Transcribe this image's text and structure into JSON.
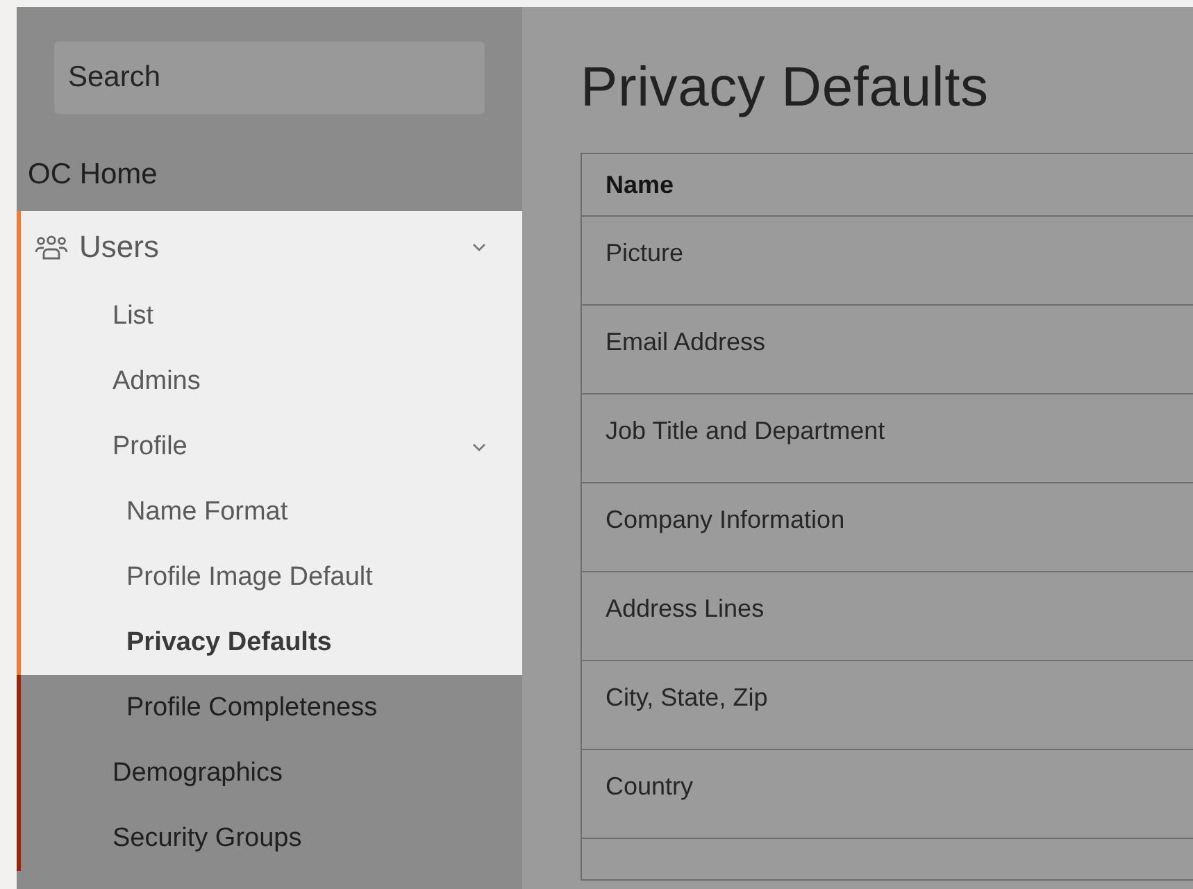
{
  "search": {
    "placeholder": "Search"
  },
  "sidebar": {
    "items": [
      {
        "label": "OC Home",
        "selected": false,
        "highlighted": false
      },
      {
        "label": "Users",
        "selected": false,
        "highlighted": true,
        "expanded": true,
        "children": [
          {
            "label": "List",
            "selected": false,
            "highlighted": true
          },
          {
            "label": "Admins",
            "selected": false,
            "highlighted": true
          },
          {
            "label": "Profile",
            "selected": false,
            "highlighted": true,
            "expanded": true,
            "children": [
              {
                "label": "Name Format",
                "selected": false,
                "highlighted": true
              },
              {
                "label": "Profile Image Default",
                "selected": false,
                "highlighted": true
              },
              {
                "label": "Privacy Defaults",
                "selected": true,
                "highlighted": true
              },
              {
                "label": "Profile Completeness",
                "selected": false,
                "highlighted": false
              }
            ]
          },
          {
            "label": "Demographics",
            "selected": false,
            "highlighted": false
          },
          {
            "label": "Security Groups",
            "selected": false,
            "highlighted": false
          }
        ]
      }
    ]
  },
  "page": {
    "title": "Privacy Defaults"
  },
  "table": {
    "columns": [
      "Name"
    ],
    "rows": [
      [
        "Picture"
      ],
      [
        "Email Address"
      ],
      [
        "Job Title and Department"
      ],
      [
        "Company Information"
      ],
      [
        "Address Lines"
      ],
      [
        "City, State, Zip"
      ],
      [
        "Country"
      ]
    ]
  }
}
